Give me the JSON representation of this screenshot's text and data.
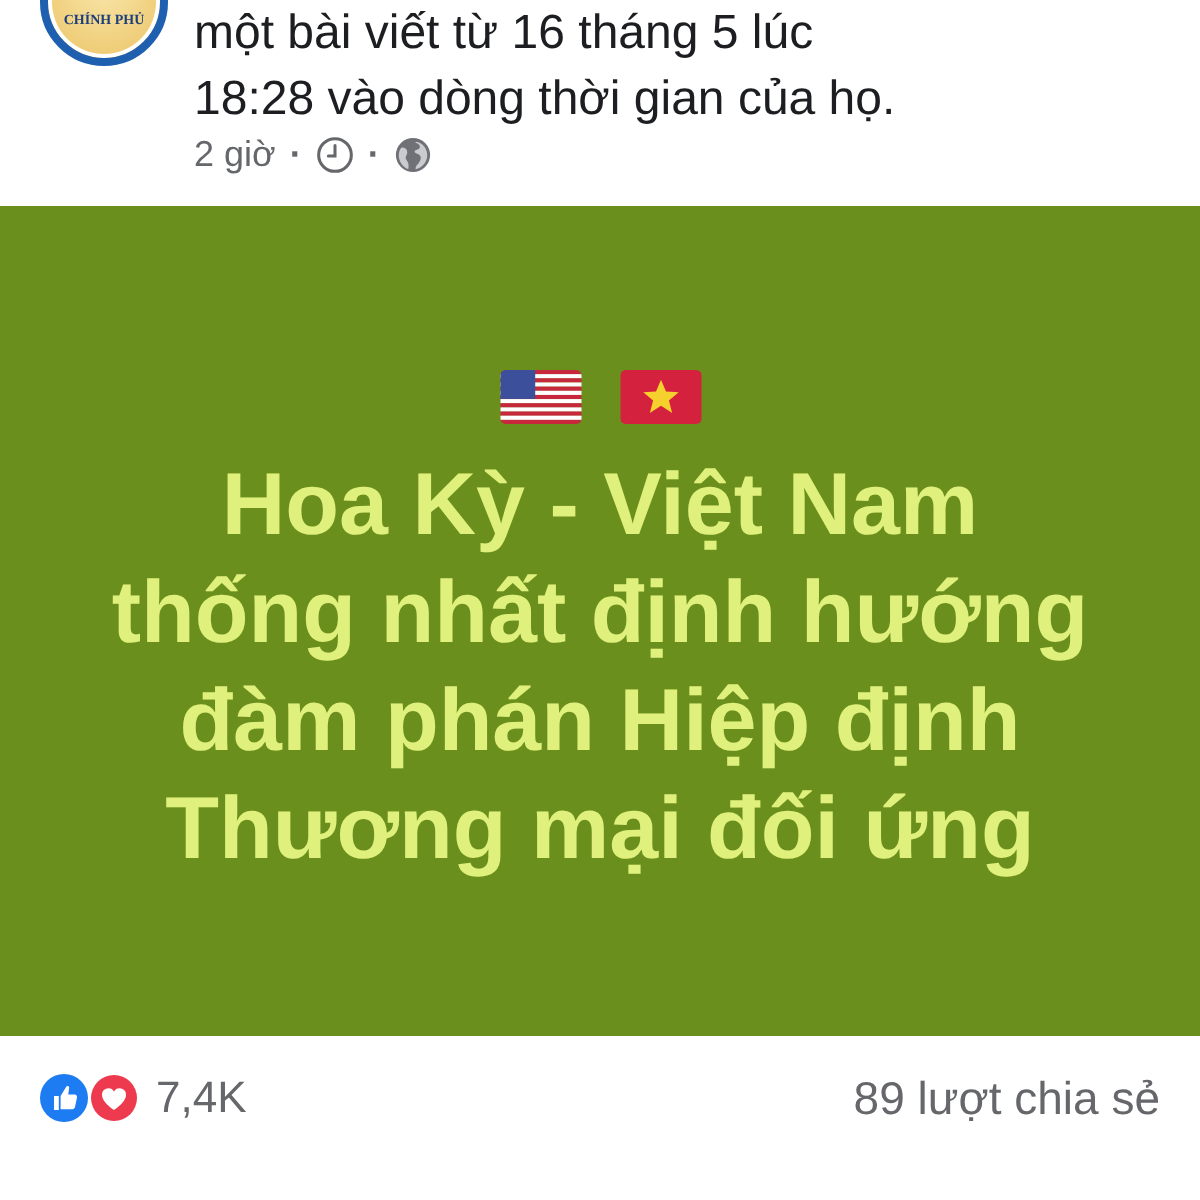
{
  "post_header": {
    "avatar": {
      "logo_text": "CHÍNH PHỦ"
    },
    "description_lines": [
      "một bài viết từ 16 tháng 5 lúc",
      "18:28 vào dòng thời gian của họ."
    ],
    "meta": {
      "time": "2 giờ",
      "separators": [
        "·",
        "·"
      ]
    }
  },
  "post_image": {
    "headline_lines": [
      "Hoa Kỳ - Việt Nam",
      "thống nhất định hướng",
      "đàm phán Hiệp định",
      "Thương mại đối ứng"
    ]
  },
  "reactions": {
    "count": "7,4K",
    "shares": "89 lượt chia sẻ"
  }
}
